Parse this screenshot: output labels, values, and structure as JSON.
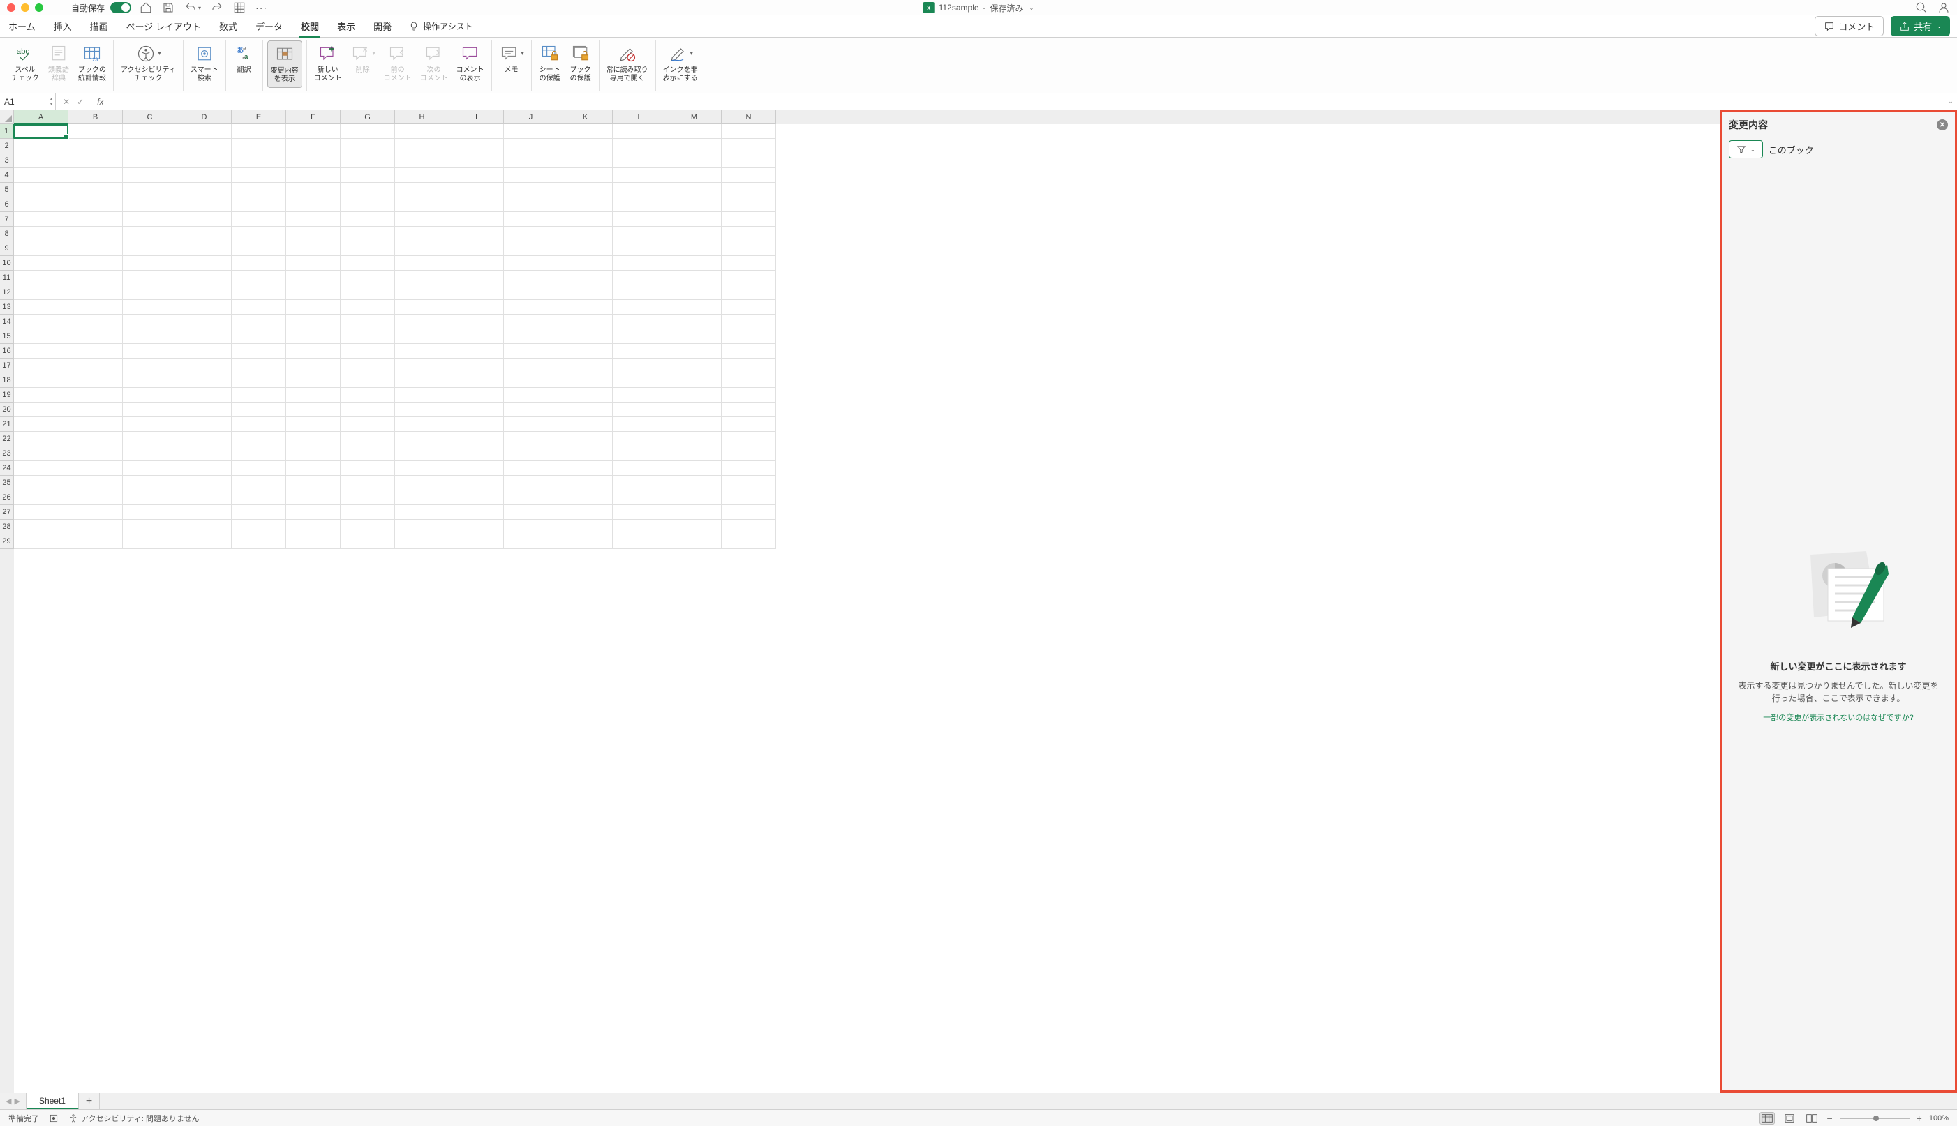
{
  "titlebar": {
    "autosave_label": "自動保存",
    "doc_name": "112sample",
    "doc_status": "保存済み"
  },
  "tabs": {
    "items": [
      "ホーム",
      "挿入",
      "描画",
      "ページ レイアウト",
      "数式",
      "データ",
      "校閲",
      "表示",
      "開発"
    ],
    "active_index": 6,
    "op_assist": "操作アシスト",
    "comment_btn": "コメント",
    "share_btn": "共有"
  },
  "ribbon": {
    "spell_check": "スペル\nチェック",
    "thesaurus": "類義語\n辞典",
    "workbook_stats": "ブックの\n統計情報",
    "accessibility": "アクセシビリティ\nチェック",
    "smart_search": "スマート\n検索",
    "translate": "翻訳",
    "show_changes": "変更内容\nを表示",
    "new_comment": "新しい\nコメント",
    "delete": "削除",
    "prev_comment": "前の\nコメント",
    "next_comment": "次の\nコメント",
    "show_comments": "コメント\nの表示",
    "notes": "メモ",
    "protect_sheet": "シート\nの保護",
    "protect_workbook": "ブック\nの保護",
    "always_readonly": "常に読み取り\n専用で開く",
    "hide_ink": "インクを非\n表示にする"
  },
  "formula_bar": {
    "name_box": "A1",
    "formula": ""
  },
  "grid": {
    "columns": [
      "A",
      "B",
      "C",
      "D",
      "E",
      "F",
      "G",
      "H",
      "I",
      "J",
      "K",
      "L",
      "M",
      "N"
    ],
    "rows": 29,
    "selected_cell": "A1"
  },
  "side_panel": {
    "title": "変更内容",
    "filter_scope": "このブック",
    "empty_heading": "新しい変更がここに表示されます",
    "empty_desc": "表示する変更は見つかりませんでした。新しい変更を行った場合、ここで表示できます。",
    "empty_link": "一部の変更が表示されないのはなぜですか?"
  },
  "sheet_tabs": {
    "active": "Sheet1"
  },
  "status_bar": {
    "ready": "準備完了",
    "accessibility": "アクセシビリティ: 問題ありません",
    "zoom": "100%"
  }
}
